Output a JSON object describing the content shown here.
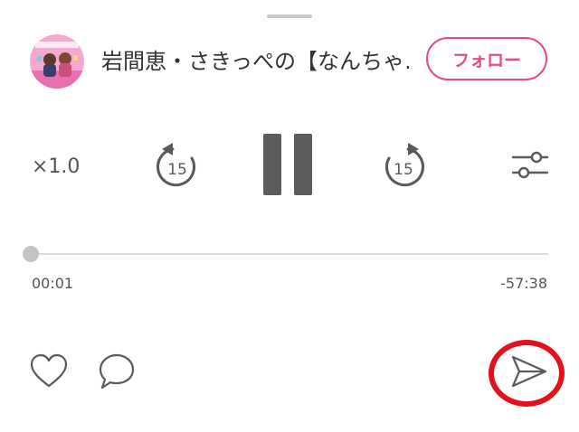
{
  "header": {
    "channel_title": "岩間恵・さきっぺの【なんちゃ…",
    "follow_label": "フォロー",
    "avatar_icon": "podcast-cover-art"
  },
  "controls": {
    "speed_label": "×1.0",
    "rewind_label": "15",
    "forward_label": "15",
    "rewind_icon": "rewind-15-icon",
    "play_state_icon": "pause-icon",
    "forward_icon": "forward-15-icon",
    "settings_icon": "sliders-icon"
  },
  "progress": {
    "elapsed": "00:01",
    "remaining": "-57:38",
    "fraction": 0.0003
  },
  "actions": {
    "like_icon": "heart-icon",
    "comment_icon": "comment-icon",
    "share_icon": "send-icon"
  },
  "colors": {
    "accent": "#e84b82",
    "icon": "#5a5a5a",
    "highlight": "#e3101d"
  }
}
